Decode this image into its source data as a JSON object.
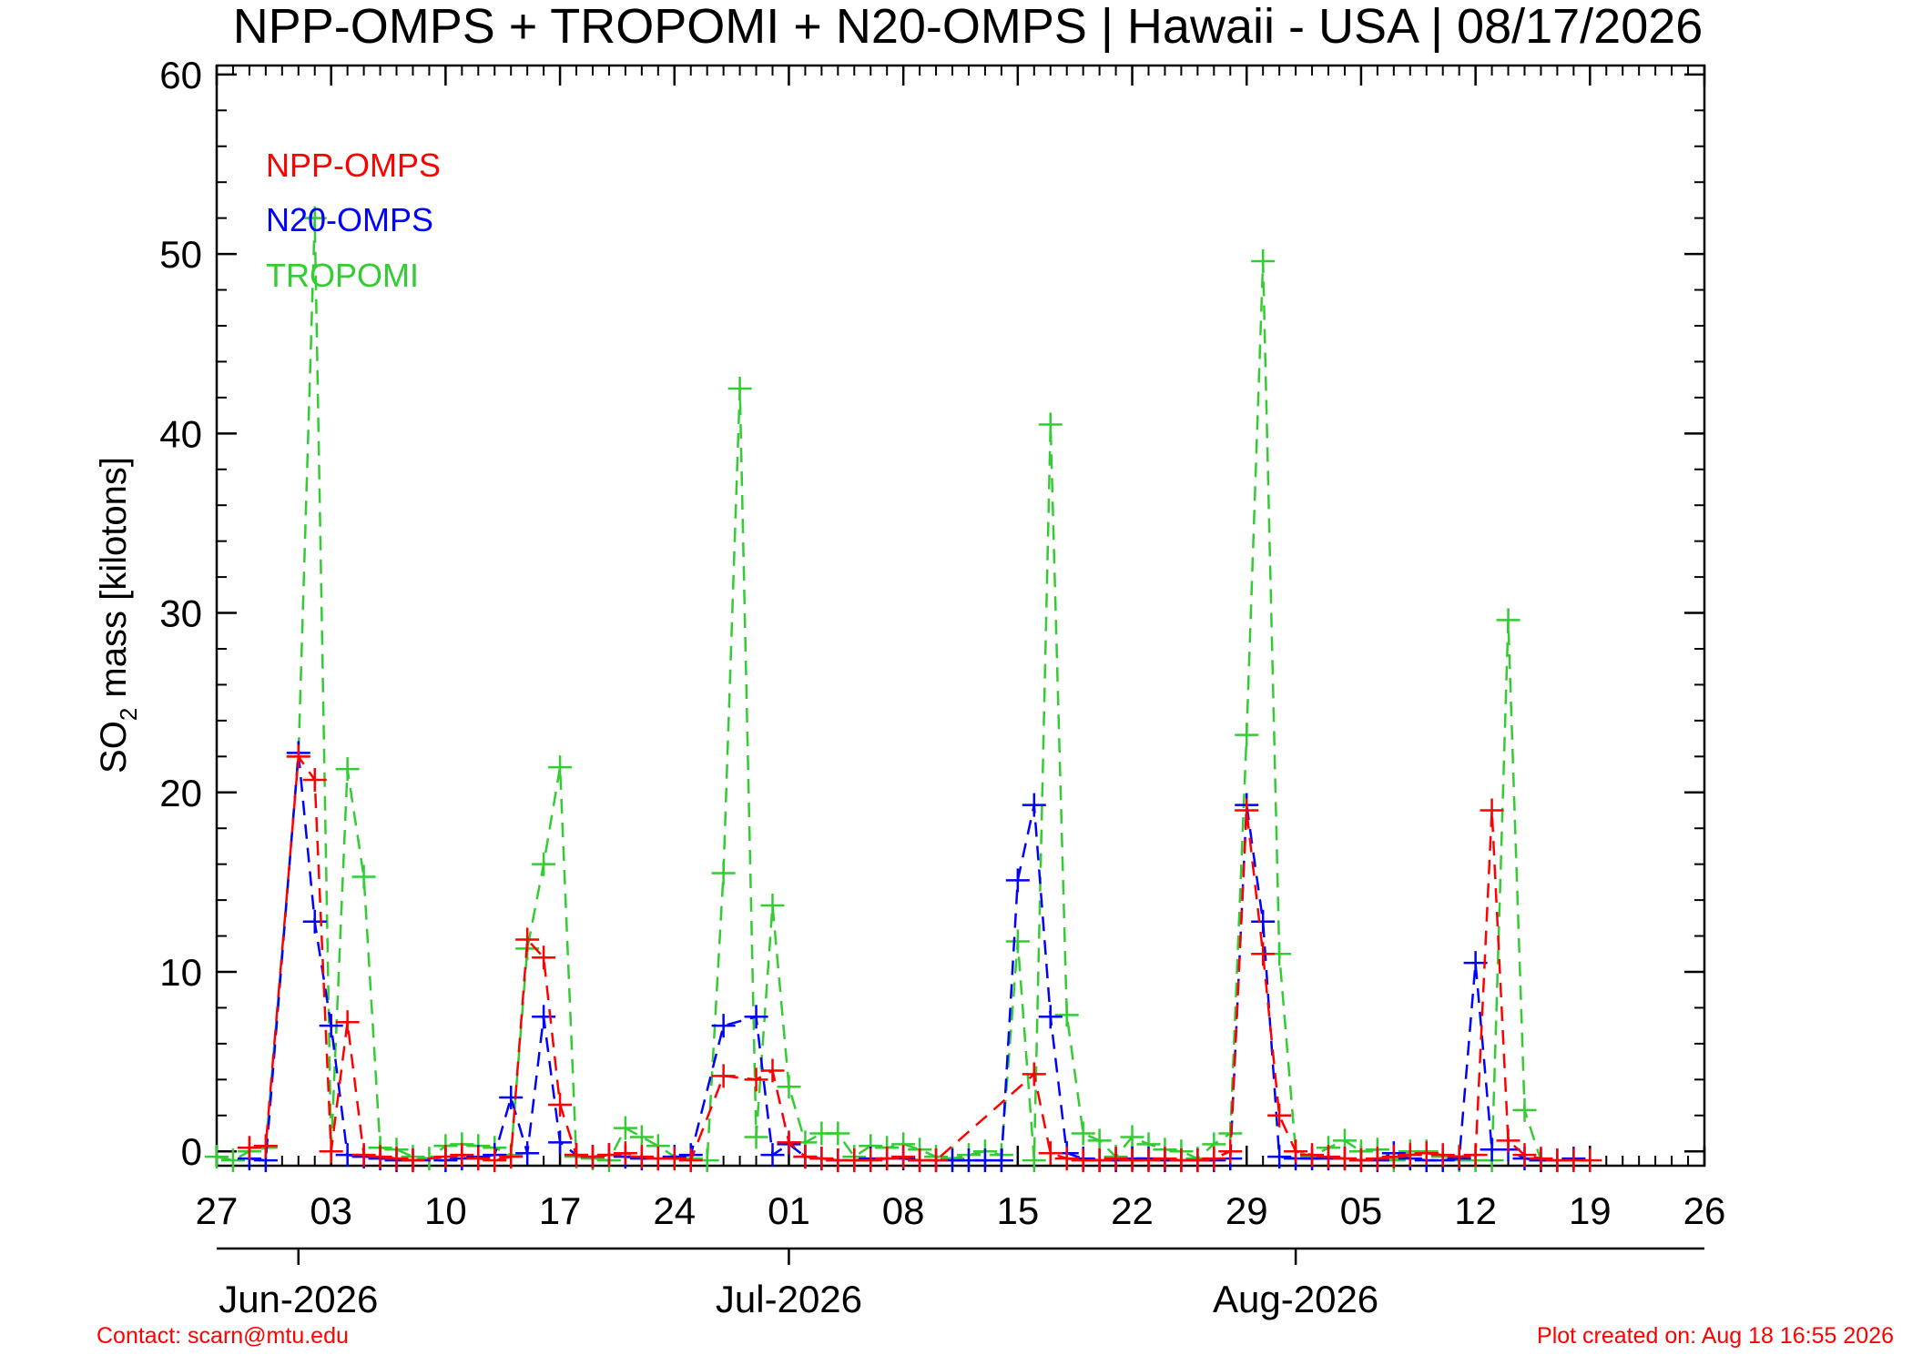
{
  "chart_data": {
    "type": "line",
    "title": "NPP-OMPS + TROPOMI + N20-OMPS | Hawaii - USA | 08/17/2026",
    "ylabel_main": "SO",
    "ylabel_sub": "2",
    "ylabel_rest": " mass [kilotons]",
    "ylim": [
      -0.8,
      60.5
    ],
    "yticks": [
      0,
      10,
      20,
      30,
      40,
      50,
      60
    ],
    "ytick_labels": [
      "0",
      "10",
      "20",
      "30",
      "40",
      "50",
      "60"
    ],
    "x_unit": "day of month",
    "xlim_dates": [
      "2026-05-27",
      "2026-08-26"
    ],
    "xticks": [
      {
        "date": "2026-05-27",
        "label": "27"
      },
      {
        "date": "2026-06-03",
        "label": "03"
      },
      {
        "date": "2026-06-10",
        "label": "10"
      },
      {
        "date": "2026-06-17",
        "label": "17"
      },
      {
        "date": "2026-06-24",
        "label": "24"
      },
      {
        "date": "2026-07-01",
        "label": "01"
      },
      {
        "date": "2026-07-08",
        "label": "08"
      },
      {
        "date": "2026-07-15",
        "label": "15"
      },
      {
        "date": "2026-07-22",
        "label": "22"
      },
      {
        "date": "2026-07-29",
        "label": "29"
      },
      {
        "date": "2026-08-05",
        "label": "05"
      },
      {
        "date": "2026-08-12",
        "label": "12"
      },
      {
        "date": "2026-08-19",
        "label": "19"
      },
      {
        "date": "2026-08-26",
        "label": "26"
      }
    ],
    "months": [
      {
        "date": "2026-06-01",
        "label": "Jun-2026"
      },
      {
        "date": "2026-07-01",
        "label": "Jul-2026"
      },
      {
        "date": "2026-08-01",
        "label": "Aug-2026"
      }
    ],
    "legend": {
      "position": "top-left"
    },
    "grid": false,
    "series": [
      {
        "name": "NPP-OMPS",
        "color": "#ff0000",
        "points": [
          [
            "2026-05-29",
            0.2
          ],
          [
            "2026-05-30",
            0.3
          ],
          [
            "2026-06-01",
            22.0
          ],
          [
            "2026-06-02",
            20.7
          ],
          [
            "2026-06-03",
            0.0
          ],
          [
            "2026-06-04",
            7.2
          ],
          [
            "2026-06-05",
            -0.2
          ],
          [
            "2026-06-06",
            -0.3
          ],
          [
            "2026-06-07",
            -0.4
          ],
          [
            "2026-06-08",
            -0.5
          ],
          [
            "2026-06-10",
            -0.3
          ],
          [
            "2026-06-11",
            -0.2
          ],
          [
            "2026-06-12",
            -0.4
          ],
          [
            "2026-06-13",
            -0.5
          ],
          [
            "2026-06-14",
            -0.3
          ],
          [
            "2026-06-15",
            11.8
          ],
          [
            "2026-06-16",
            10.8
          ],
          [
            "2026-06-17",
            2.6
          ],
          [
            "2026-06-18",
            -0.2
          ],
          [
            "2026-06-19",
            -0.3
          ],
          [
            "2026-06-20",
            -0.2
          ],
          [
            "2026-06-21",
            -0.1
          ],
          [
            "2026-06-22",
            -0.3
          ],
          [
            "2026-06-23",
            -0.4
          ],
          [
            "2026-06-24",
            -0.4
          ],
          [
            "2026-06-25",
            -0.5
          ],
          [
            "2026-06-27",
            4.2
          ],
          [
            "2026-06-29",
            4.0
          ],
          [
            "2026-06-30",
            4.5
          ],
          [
            "2026-07-01",
            0.5
          ],
          [
            "2026-07-02",
            -0.3
          ],
          [
            "2026-07-03",
            -0.4
          ],
          [
            "2026-07-04",
            -0.5
          ],
          [
            "2026-07-05",
            -0.5
          ],
          [
            "2026-07-06",
            -0.5
          ],
          [
            "2026-07-07",
            -0.4
          ],
          [
            "2026-07-08",
            -0.3
          ],
          [
            "2026-07-09",
            -0.5
          ],
          [
            "2026-07-10",
            -0.5
          ],
          [
            "2026-07-16",
            4.3
          ],
          [
            "2026-07-17",
            -0.1
          ],
          [
            "2026-07-18",
            -0.4
          ],
          [
            "2026-07-19",
            -0.5
          ],
          [
            "2026-07-20",
            -0.5
          ],
          [
            "2026-07-21",
            -0.4
          ],
          [
            "2026-07-22",
            -0.5
          ],
          [
            "2026-07-23",
            -0.5
          ],
          [
            "2026-07-24",
            -0.4
          ],
          [
            "2026-07-25",
            -0.5
          ],
          [
            "2026-07-26",
            -0.5
          ],
          [
            "2026-07-27",
            -0.4
          ],
          [
            "2026-07-28",
            0.0
          ],
          [
            "2026-07-29",
            19.0
          ],
          [
            "2026-07-30",
            11.0
          ],
          [
            "2026-07-31",
            2.0
          ],
          [
            "2026-08-01",
            0.0
          ],
          [
            "2026-08-02",
            -0.2
          ],
          [
            "2026-08-03",
            -0.3
          ],
          [
            "2026-08-04",
            -0.4
          ],
          [
            "2026-08-05",
            -0.5
          ],
          [
            "2026-08-06",
            -0.4
          ],
          [
            "2026-08-07",
            -0.3
          ],
          [
            "2026-08-08",
            -0.2
          ],
          [
            "2026-08-09",
            -0.1
          ],
          [
            "2026-08-10",
            -0.2
          ],
          [
            "2026-08-11",
            -0.3
          ],
          [
            "2026-08-12",
            -0.2
          ],
          [
            "2026-08-13",
            19.0
          ],
          [
            "2026-08-14",
            0.6
          ],
          [
            "2026-08-15",
            -0.2
          ],
          [
            "2026-08-16",
            -0.4
          ],
          [
            "2026-08-17",
            -0.5
          ],
          [
            "2026-08-18",
            -0.5
          ],
          [
            "2026-08-19",
            -0.5
          ]
        ]
      },
      {
        "name": "N20-OMPS",
        "color": "#0000ff",
        "points": [
          [
            "2026-05-29",
            -0.4
          ],
          [
            "2026-05-30",
            -0.5
          ],
          [
            "2026-06-01",
            22.2
          ],
          [
            "2026-06-02",
            12.8
          ],
          [
            "2026-06-03",
            7.0
          ],
          [
            "2026-06-04",
            -0.2
          ],
          [
            "2026-06-05",
            -0.3
          ],
          [
            "2026-06-06",
            -0.4
          ],
          [
            "2026-06-07",
            -0.5
          ],
          [
            "2026-06-08",
            -0.5
          ],
          [
            "2026-06-10",
            -0.5
          ],
          [
            "2026-06-11",
            -0.4
          ],
          [
            "2026-06-12",
            -0.3
          ],
          [
            "2026-06-13",
            -0.2
          ],
          [
            "2026-06-14",
            3.0
          ],
          [
            "2026-06-15",
            -0.1
          ],
          [
            "2026-06-16",
            7.5
          ],
          [
            "2026-06-17",
            0.5
          ],
          [
            "2026-06-18",
            -0.2
          ],
          [
            "2026-06-19",
            -0.3
          ],
          [
            "2026-06-20",
            -0.2
          ],
          [
            "2026-06-21",
            -0.3
          ],
          [
            "2026-06-22",
            -0.4
          ],
          [
            "2026-06-23",
            -0.4
          ],
          [
            "2026-06-24",
            -0.3
          ],
          [
            "2026-06-25",
            -0.2
          ],
          [
            "2026-06-27",
            7.0
          ],
          [
            "2026-06-29",
            7.5
          ],
          [
            "2026-06-30",
            -0.2
          ],
          [
            "2026-07-01",
            0.4
          ],
          [
            "2026-07-02",
            -0.3
          ],
          [
            "2026-07-03",
            -0.4
          ],
          [
            "2026-07-04",
            -0.5
          ],
          [
            "2026-07-05",
            -0.5
          ],
          [
            "2026-07-06",
            -0.4
          ],
          [
            "2026-07-07",
            -0.4
          ],
          [
            "2026-07-08",
            -0.4
          ],
          [
            "2026-07-09",
            -0.5
          ],
          [
            "2026-07-10",
            -0.5
          ],
          [
            "2026-07-11",
            -0.5
          ],
          [
            "2026-07-12",
            -0.5
          ],
          [
            "2026-07-13",
            -0.5
          ],
          [
            "2026-07-14",
            -0.5
          ],
          [
            "2026-07-15",
            15.1
          ],
          [
            "2026-07-16",
            19.3
          ],
          [
            "2026-07-17",
            7.5
          ],
          [
            "2026-07-18",
            -0.1
          ],
          [
            "2026-07-19",
            -0.4
          ],
          [
            "2026-07-20",
            -0.5
          ],
          [
            "2026-07-21",
            -0.5
          ],
          [
            "2026-07-22",
            -0.4
          ],
          [
            "2026-07-23",
            -0.4
          ],
          [
            "2026-07-24",
            -0.5
          ],
          [
            "2026-07-25",
            -0.5
          ],
          [
            "2026-07-26",
            -0.5
          ],
          [
            "2026-07-27",
            -0.5
          ],
          [
            "2026-07-28",
            -0.4
          ],
          [
            "2026-07-29",
            19.3
          ],
          [
            "2026-07-30",
            12.8
          ],
          [
            "2026-07-31",
            -0.3
          ],
          [
            "2026-08-01",
            -0.4
          ],
          [
            "2026-08-02",
            -0.4
          ],
          [
            "2026-08-03",
            -0.4
          ],
          [
            "2026-08-04",
            -0.4
          ],
          [
            "2026-08-05",
            -0.5
          ],
          [
            "2026-08-06",
            -0.5
          ],
          [
            "2026-08-07",
            -0.1
          ],
          [
            "2026-08-08",
            -0.4
          ],
          [
            "2026-08-09",
            -0.5
          ],
          [
            "2026-08-10",
            -0.5
          ],
          [
            "2026-08-11",
            -0.4
          ],
          [
            "2026-08-12",
            10.5
          ],
          [
            "2026-08-13",
            0.1
          ],
          [
            "2026-08-14",
            0.1
          ],
          [
            "2026-08-15",
            -0.4
          ],
          [
            "2026-08-16",
            -0.5
          ],
          [
            "2026-08-17",
            -0.5
          ],
          [
            "2026-08-18",
            -0.4
          ]
        ]
      },
      {
        "name": "TROPOMI",
        "color": "#33cc33",
        "points": [
          [
            "2026-05-27",
            -0.3
          ],
          [
            "2026-05-28",
            -0.5
          ],
          [
            "2026-05-29",
            0.0
          ],
          [
            "2026-05-30",
            0.2
          ],
          [
            "2026-06-01",
            22.0
          ],
          [
            "2026-06-02",
            52.0
          ],
          [
            "2026-06-03",
            0.0
          ],
          [
            "2026-06-04",
            21.3
          ],
          [
            "2026-06-05",
            15.3
          ],
          [
            "2026-06-06",
            0.2
          ],
          [
            "2026-06-07",
            0.1
          ],
          [
            "2026-06-08",
            -0.3
          ],
          [
            "2026-06-09",
            -0.4
          ],
          [
            "2026-06-10",
            0.3
          ],
          [
            "2026-06-11",
            0.4
          ],
          [
            "2026-06-12",
            0.3
          ],
          [
            "2026-06-13",
            0.2
          ],
          [
            "2026-06-14",
            -0.2
          ],
          [
            "2026-06-15",
            11.3
          ],
          [
            "2026-06-16",
            16.0
          ],
          [
            "2026-06-17",
            21.4
          ],
          [
            "2026-06-18",
            -0.3
          ],
          [
            "2026-06-19",
            -0.4
          ],
          [
            "2026-06-20",
            -0.5
          ],
          [
            "2026-06-21",
            1.3
          ],
          [
            "2026-06-22",
            0.8
          ],
          [
            "2026-06-23",
            0.3
          ],
          [
            "2026-06-24",
            -0.3
          ],
          [
            "2026-06-25",
            -0.4
          ],
          [
            "2026-06-26",
            -0.5
          ],
          [
            "2026-06-27",
            15.5
          ],
          [
            "2026-06-28",
            42.5
          ],
          [
            "2026-06-29",
            0.8
          ],
          [
            "2026-06-30",
            13.7
          ],
          [
            "2026-07-01",
            3.6
          ],
          [
            "2026-07-02",
            0.5
          ],
          [
            "2026-07-03",
            1.0
          ],
          [
            "2026-07-04",
            1.0
          ],
          [
            "2026-07-05",
            -0.3
          ],
          [
            "2026-07-06",
            0.3
          ],
          [
            "2026-07-07",
            0.2
          ],
          [
            "2026-07-08",
            0.4
          ],
          [
            "2026-07-09",
            0.1
          ],
          [
            "2026-07-10",
            -0.3
          ],
          [
            "2026-07-11",
            -0.4
          ],
          [
            "2026-07-12",
            -0.2
          ],
          [
            "2026-07-13",
            0.0
          ],
          [
            "2026-07-14",
            -0.2
          ],
          [
            "2026-07-15",
            11.7
          ],
          [
            "2026-07-16",
            -0.5
          ],
          [
            "2026-07-17",
            40.5
          ],
          [
            "2026-07-18",
            7.6
          ],
          [
            "2026-07-19",
            1.0
          ],
          [
            "2026-07-20",
            0.6
          ],
          [
            "2026-07-21",
            -0.3
          ],
          [
            "2026-07-22",
            0.8
          ],
          [
            "2026-07-23",
            0.4
          ],
          [
            "2026-07-24",
            0.1
          ],
          [
            "2026-07-25",
            0.0
          ],
          [
            "2026-07-26",
            -0.4
          ],
          [
            "2026-07-27",
            0.4
          ],
          [
            "2026-07-28",
            1.0
          ],
          [
            "2026-07-29",
            23.2
          ],
          [
            "2026-07-30",
            49.6
          ],
          [
            "2026-07-31",
            11.0
          ],
          [
            "2026-08-01",
            0.0
          ],
          [
            "2026-08-02",
            -0.3
          ],
          [
            "2026-08-03",
            0.2
          ],
          [
            "2026-08-04",
            0.6
          ],
          [
            "2026-08-05",
            0.0
          ],
          [
            "2026-08-06",
            0.1
          ],
          [
            "2026-08-07",
            -0.5
          ],
          [
            "2026-08-08",
            0.0
          ],
          [
            "2026-08-09",
            0.0
          ],
          [
            "2026-08-10",
            -0.3
          ],
          [
            "2026-08-11",
            -0.5
          ],
          [
            "2026-08-12",
            -0.5
          ],
          [
            "2026-08-13",
            -0.5
          ],
          [
            "2026-08-14",
            29.6
          ],
          [
            "2026-08-15",
            2.3
          ],
          [
            "2026-08-16",
            -0.5
          ]
        ]
      }
    ]
  },
  "footer": {
    "contact": "Contact: scarn@mtu.edu",
    "created": "Plot created on: Aug 18 16:55 2026"
  },
  "colors": {
    "npp": "#ff0000",
    "n20": "#0000ff",
    "tropomi": "#33cc33"
  }
}
